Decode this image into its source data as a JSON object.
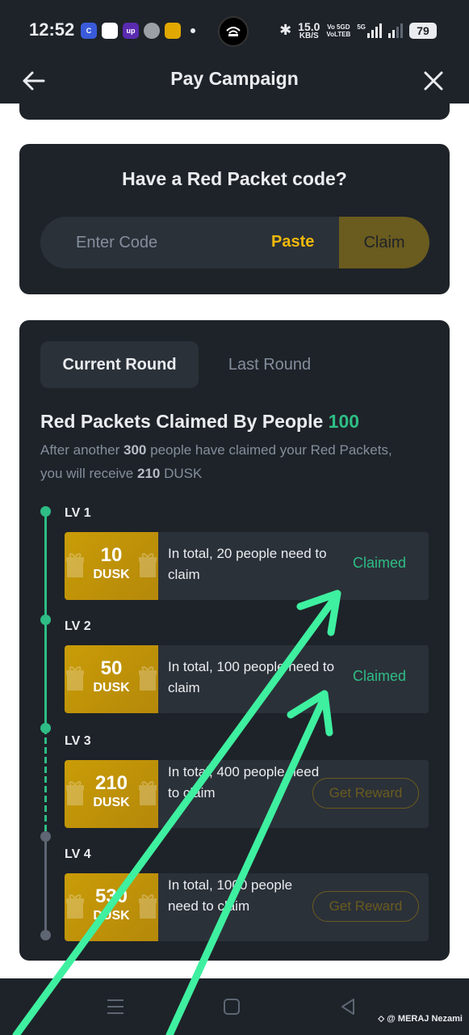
{
  "status_bar": {
    "time": "12:52",
    "app_icons": [
      {
        "name": "chrome-like-icon",
        "color": "#3a5bd9",
        "label": "C"
      },
      {
        "name": "bank-icon",
        "color": "#ffffff",
        "label": ""
      },
      {
        "name": "upstox-icon",
        "color": "#5a2bb0",
        "label": "up"
      },
      {
        "name": "chrome-icon",
        "color": "#9aa0a6",
        "label": ""
      },
      {
        "name": "wallet-icon",
        "color": "#e0a800",
        "label": ""
      }
    ],
    "speed_value": "15.0",
    "speed_unit": "KB/S",
    "network_1": "Vo 5GD",
    "network_2": "VoLTEB",
    "network_3": "5G",
    "battery": "79"
  },
  "header": {
    "title": "Pay Campaign"
  },
  "red_packet_code": {
    "title": "Have a Red Packet code?",
    "input_placeholder": "Enter Code",
    "paste_label": "Paste",
    "claim_label": "Claim"
  },
  "rounds": {
    "tabs": [
      "Current Round",
      "Last Round"
    ],
    "active_tab": "Current Round",
    "heading_prefix": "Red Packets Claimed By People",
    "claimed_count": "100",
    "desc_1": "After another",
    "desc_people": "300",
    "desc_2": "people have claimed your Red Packets, you will receive",
    "desc_amount": "210",
    "desc_3": "DUSK",
    "levels": [
      {
        "label": "LV 1",
        "amount": "10",
        "unit": "DUSK",
        "description": "In total, 20 people need to claim",
        "status": "Claimed"
      },
      {
        "label": "LV 2",
        "amount": "50",
        "unit": "DUSK",
        "description": "In total, 100 people need to claim",
        "status": "Claimed"
      },
      {
        "label": "LV 3",
        "amount": "210",
        "unit": "DUSK",
        "description": "In total, 400 people need to claim",
        "status": "Get Reward"
      },
      {
        "label": "LV 4",
        "amount": "530",
        "unit": "DUSK",
        "description": "In total, 1000 people need to claim",
        "status": "Get Reward"
      }
    ]
  },
  "colors": {
    "background": "#1e2329",
    "panel": "#2b3139",
    "accent_yellow": "#f0b90b",
    "claimed_green": "#2ebd85",
    "arrow_annotation": "#3ef0a0"
  },
  "watermark": "@ MERAJ Nezami"
}
